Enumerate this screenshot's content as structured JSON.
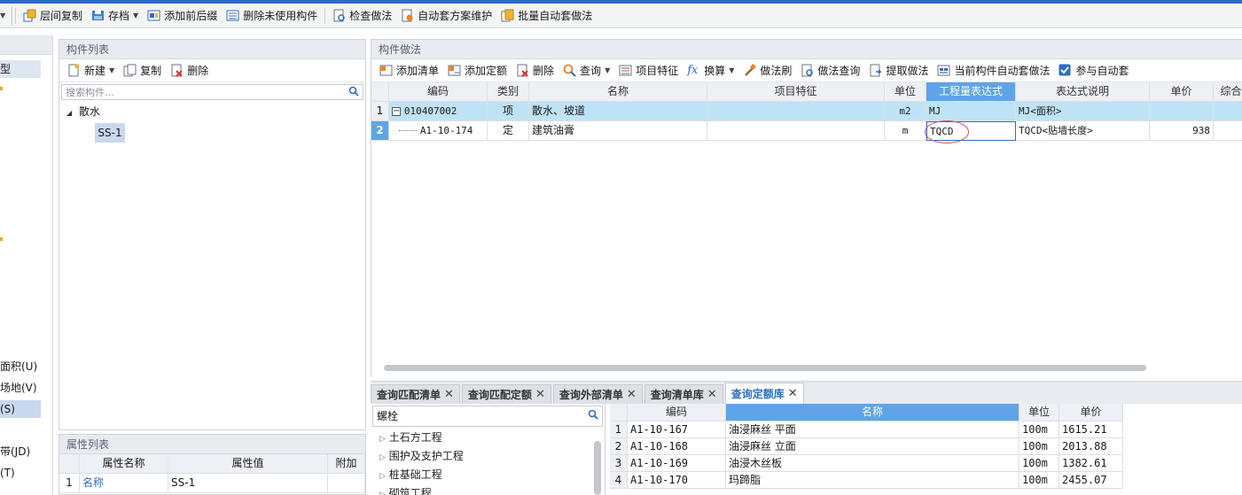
{
  "toolbar": {
    "items": [
      {
        "label": "层间复制",
        "icon": "floor-copy-icon"
      },
      {
        "label": "存档",
        "icon": "archive-icon"
      },
      {
        "label": "添加前后缀",
        "icon": "add-prefix-suffix-icon"
      },
      {
        "label": "删除未使用构件",
        "icon": "delete-unused-icon"
      },
      {
        "label": "检查做法",
        "icon": "check-method-icon"
      },
      {
        "label": "自动套方案维护",
        "icon": "auto-scheme-icon"
      },
      {
        "label": "批量自动套做法",
        "icon": "batch-auto-icon"
      }
    ]
  },
  "left_strip": {
    "items": [
      "型",
      "面积(U)",
      "场地(V)",
      "(S)",
      "带(JD)",
      "(T)"
    ]
  },
  "component_list": {
    "title": "构件列表",
    "new_label": "新建",
    "copy_label": "复制",
    "delete_label": "删除",
    "search_placeholder": "搜索构件...",
    "tree_root": "散水",
    "tree_child": "SS-1"
  },
  "attr_list": {
    "title": "属性列表",
    "headers": [
      "属性名称",
      "属性值",
      "附加"
    ],
    "row": {
      "num": "1",
      "name": "名称",
      "value": "SS-1"
    }
  },
  "method_panel": {
    "title": "构件做法",
    "toolbar": [
      "添加清单",
      "添加定额",
      "删除",
      "查询",
      "项目特征",
      "换算",
      "做法刷",
      "做法查询",
      "提取做法",
      "当前构件自动套做法",
      "参与自动套"
    ],
    "headers": [
      "编码",
      "类别",
      "名称",
      "项目特征",
      "单位",
      "工程量表达式",
      "表达式说明",
      "单价",
      "综合"
    ],
    "rows": [
      {
        "num": "1",
        "code": "010407002",
        "type": "项",
        "name": "散水、坡道",
        "feature": "",
        "unit": "m2",
        "expr": "MJ",
        "desc": "MJ<面积>",
        "price": ""
      },
      {
        "num": "2",
        "code": "A1-10-174",
        "type": "定",
        "name": "建筑油膏",
        "feature": "",
        "unit": "m",
        "expr": "TQCD",
        "desc": "TQCD<贴墙长度>",
        "price": "938"
      }
    ]
  },
  "bottom_tabs": [
    {
      "label": "查询匹配清单",
      "active": false
    },
    {
      "label": "查询匹配定额",
      "active": false
    },
    {
      "label": "查询外部清单",
      "active": false
    },
    {
      "label": "查询清单库",
      "active": false
    },
    {
      "label": "查询定额库",
      "active": true
    }
  ],
  "query": {
    "search_value": "螺栓",
    "tree": [
      "土石方工程",
      "围护及支护工程",
      "桩基础工程",
      "砌筑工程"
    ],
    "headers": [
      "编码",
      "名称",
      "单位",
      "单价"
    ],
    "rows": [
      {
        "num": "1",
        "code": "A1-10-167",
        "name": "油浸麻丝 平面",
        "unit": "100m",
        "price": "1615.21"
      },
      {
        "num": "2",
        "code": "A1-10-168",
        "name": "油浸麻丝 立面",
        "unit": "100m",
        "price": "2013.88"
      },
      {
        "num": "3",
        "code": "A1-10-169",
        "name": "油浸木丝板",
        "unit": "100m",
        "price": "1382.61"
      },
      {
        "num": "4",
        "code": "A1-10-170",
        "name": "玛蹄脂",
        "unit": "100m",
        "price": "2455.07"
      }
    ]
  },
  "colors": {
    "accent": "#2d6cc4",
    "header_highlight": "#5fa4e8",
    "row_selected": "#bfe3f6",
    "annotation": "#d9534f"
  }
}
